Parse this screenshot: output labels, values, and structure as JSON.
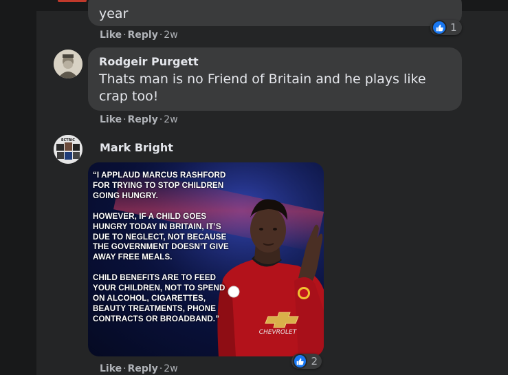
{
  "colors": {
    "background": "#18191a",
    "card": "#242526",
    "bubble": "#3a3b3c",
    "text": "#e4e6eb",
    "muted": "#b0b3b8",
    "like_blue": "#1877f2"
  },
  "comments": [
    {
      "body_fragment": "year",
      "actions": {
        "like": "Like",
        "reply": "Reply",
        "time": "2w"
      },
      "reactions": {
        "icon": "like-icon",
        "count": "1"
      }
    },
    {
      "author": "Rodgeir Purgett",
      "body": "Thats man is no Friend of Britain and he plays like crap too!",
      "actions": {
        "like": "Like",
        "reply": "Reply",
        "time": "2w"
      }
    },
    {
      "author": "Mark Bright",
      "avatar_text": "ECTRIC",
      "image_text": [
        "“I APPLAUD MARCUS RASHFORD FOR TRYING TO STOP CHILDREN GOING HUNGRY.",
        "HOWEVER, IF A CHILD GOES HUNGRY TODAY IN BRITAIN, IT’S DUE TO NEGLECT, NOT BECAUSE THE GOVERNMENT DOESN’T GIVE AWAY FREE MEALS.",
        "CHILD BENEFITS ARE TO FEED YOUR CHILDREN, NOT TO SPEND ON ALCOHOL, CIGARETTES, BEAUTY TREATMENTS, PHONE CONTRACTS OR BROADBAND.”"
      ],
      "shirt_sponsor": "CHEVROLET",
      "actions": {
        "like": "Like",
        "reply": "Reply",
        "time": "2w"
      },
      "reactions": {
        "icon": "like-icon",
        "count": "2"
      }
    }
  ]
}
